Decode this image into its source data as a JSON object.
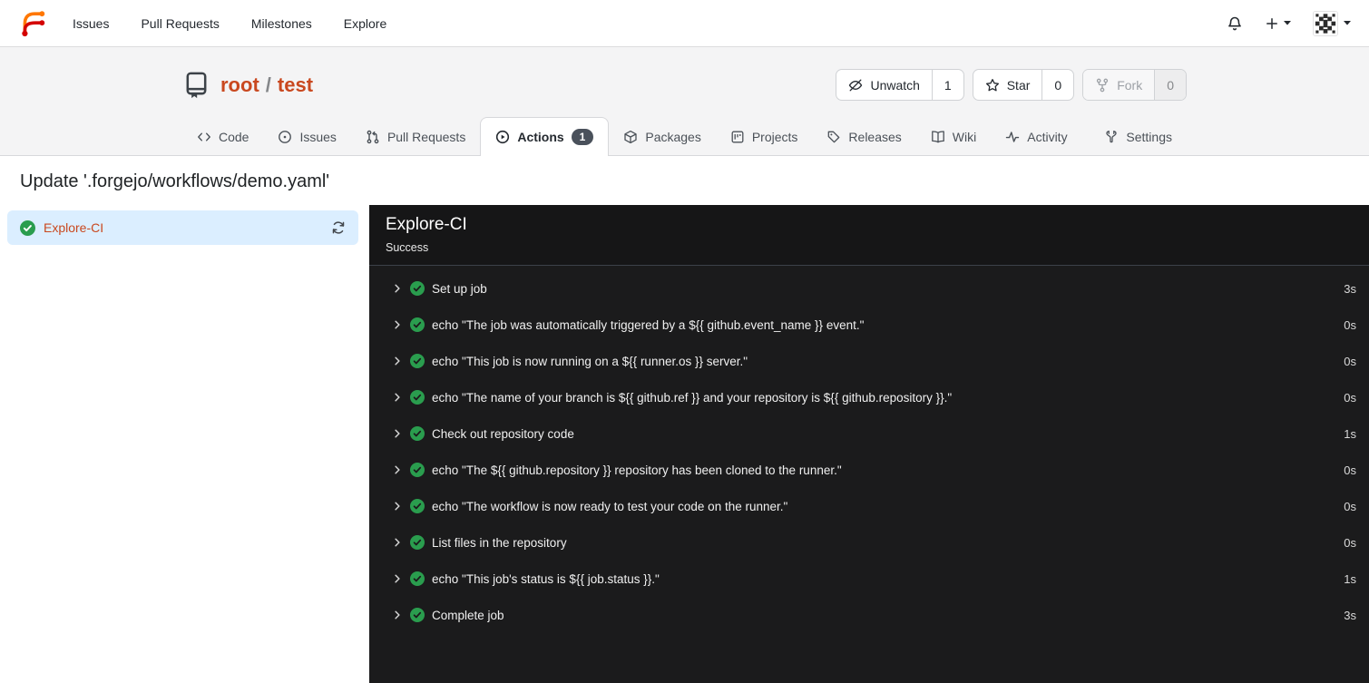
{
  "navbar": {
    "links": [
      {
        "label": "Issues"
      },
      {
        "label": "Pull Requests"
      },
      {
        "label": "Milestones"
      },
      {
        "label": "Explore"
      }
    ]
  },
  "repo_header": {
    "owner": "root",
    "separator": "/",
    "name": "test",
    "actions": [
      {
        "label": "Unwatch",
        "count": "1"
      },
      {
        "label": "Star",
        "count": "0"
      },
      {
        "label": "Fork",
        "count": "0",
        "disabled": true
      }
    ]
  },
  "tabs": [
    {
      "label": "Code"
    },
    {
      "label": "Issues"
    },
    {
      "label": "Pull Requests"
    },
    {
      "label": "Actions",
      "count": "1",
      "active": true
    },
    {
      "label": "Packages"
    },
    {
      "label": "Projects"
    },
    {
      "label": "Releases"
    },
    {
      "label": "Wiki"
    },
    {
      "label": "Activity"
    },
    {
      "label": "Settings"
    }
  ],
  "page": {
    "title": "Update '.forgejo/workflows/demo.yaml'"
  },
  "jobs_sidebar": {
    "items": [
      {
        "name": "Explore-CI",
        "status": "success"
      }
    ]
  },
  "run_panel": {
    "title": "Explore-CI",
    "status": "Success",
    "steps": [
      {
        "label": "Set up job",
        "duration": "3s"
      },
      {
        "label": "echo \"The job was automatically triggered by a ${{ github.event_name }} event.\"",
        "duration": "0s"
      },
      {
        "label": "echo \"This job is now running on a ${{ runner.os }} server.\"",
        "duration": "0s"
      },
      {
        "label": "echo \"The name of your branch is ${{ github.ref }} and your repository is ${{ github.repository }}.\"",
        "duration": "0s"
      },
      {
        "label": "Check out repository code",
        "duration": "1s"
      },
      {
        "label": "echo \"The ${{ github.repository }} repository has been cloned to the runner.\"",
        "duration": "0s"
      },
      {
        "label": "echo \"The workflow is now ready to test your code on the runner.\"",
        "duration": "0s"
      },
      {
        "label": "List files in the repository",
        "duration": "0s"
      },
      {
        "label": "echo \"This job's status is ${{ job.status }}.\"",
        "duration": "1s"
      },
      {
        "label": "Complete job",
        "duration": "3s"
      }
    ]
  },
  "colors": {
    "accent": "#c9481f",
    "success_green": "#2a9d4e",
    "selected_job_bg": "#dbeeff",
    "panel_bg": "#1b1b1c",
    "header_bg": "#f4f4f5"
  }
}
